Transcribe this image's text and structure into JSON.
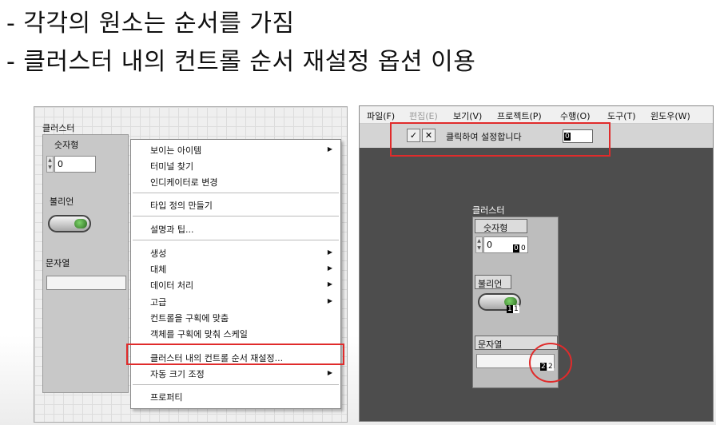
{
  "bullets": [
    "- 각각의 원소는 순서를 가짐",
    "- 클러스터 내의 컨트롤 순서 재설정 옵션 이용"
  ],
  "left_panel": {
    "cluster_label": "클러스터",
    "numeric_label": "숫자형",
    "numeric_value": "0",
    "boolean_label": "불리언",
    "string_label": "문자열"
  },
  "context_menu": {
    "items": [
      "보이는 아이템",
      "터미널 찾기",
      "인디케이터로 변경",
      "타입 정의 만들기",
      "설명과 팁...",
      "생성",
      "대체",
      "데이터 처리",
      "고급",
      "컨트롤을 구획에 맞춤",
      "객체를 구획에 맞춰 스케일",
      "클러스터 내의 컨트롤 순서 재설정...",
      "자동 크기 조정",
      "프로퍼티"
    ],
    "highlighted": "클러스터 내의 컨트롤 순서 재설정..."
  },
  "right_panel": {
    "menubar": [
      "파일(F)",
      "편집(E)",
      "보기(V)",
      "프로젝트(P)",
      "수행(O)",
      "도구(T)",
      "윈도우(W)"
    ],
    "toolbar": {
      "ok_icon": "✓",
      "cancel_icon": "✕",
      "prompt": "클릭하여 설정합니다",
      "order_value": "0"
    },
    "cluster_label": "클러스터",
    "numeric_label": "숫자형",
    "numeric_value": "0",
    "numeric_order": [
      "0",
      "0"
    ],
    "boolean_label": "불리언",
    "boolean_order": [
      "1",
      "1"
    ],
    "string_label": "문자열",
    "string_order": [
      "2",
      "2"
    ]
  },
  "colors": {
    "highlight": "#e02b2b",
    "led": "#3f8f2f",
    "panel_dark": "#4d4d4d"
  }
}
